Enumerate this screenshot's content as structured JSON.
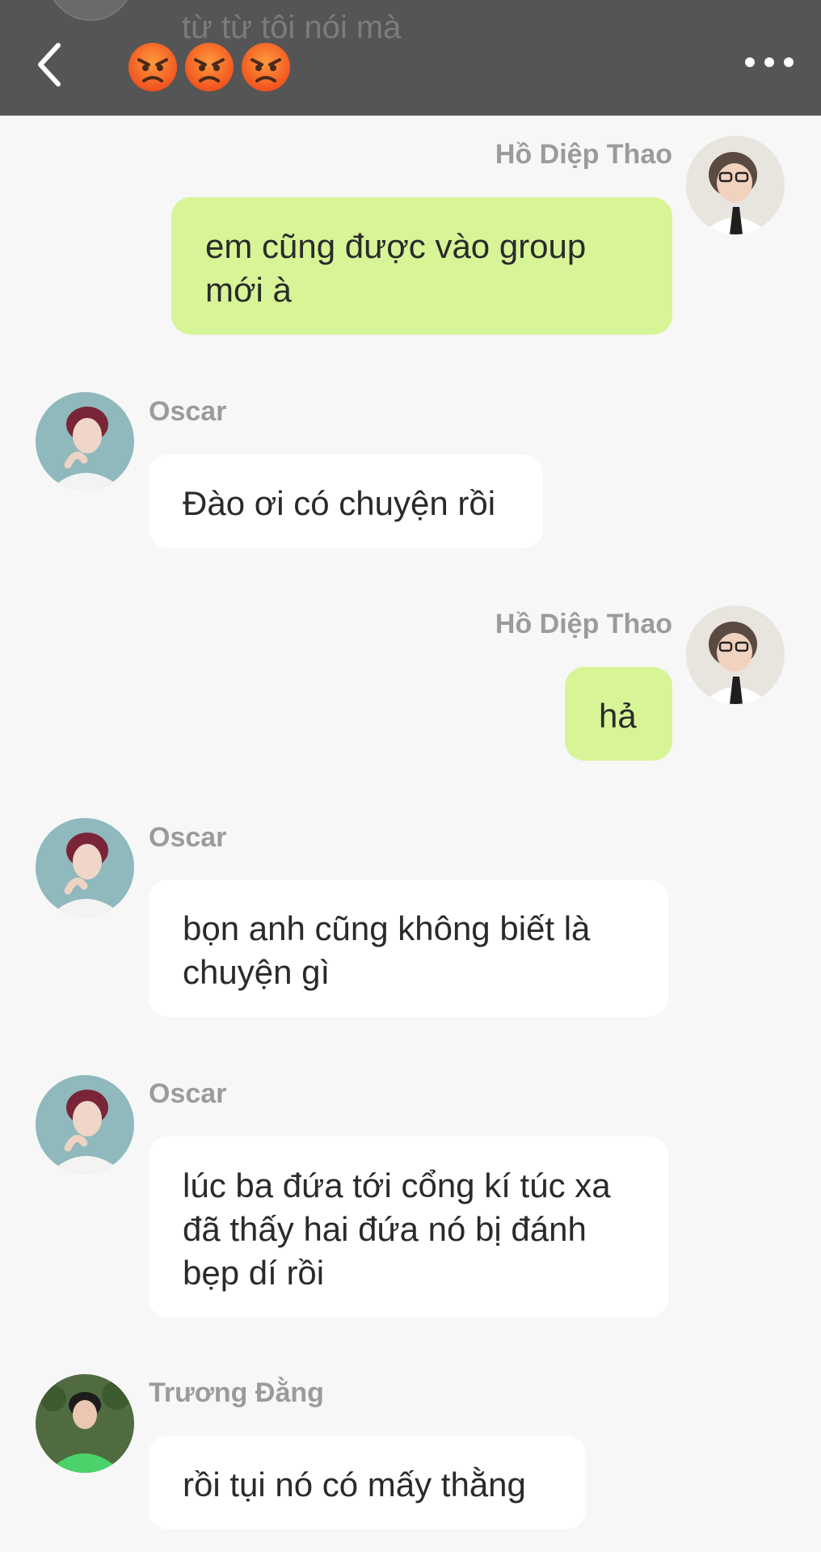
{
  "header": {
    "previous_message_preview": "từ từ tôi nói mà",
    "title_emojis": [
      "pouting-face-emoji",
      "pouting-face-emoji",
      "pouting-face-emoji"
    ],
    "back_icon": "chevron-left-icon",
    "more_icon": "more-horizontal-icon"
  },
  "colors": {
    "header_bg": "#555555",
    "chat_bg": "#f7f7f7",
    "my_bubble": "#d7f597",
    "other_bubble": "#ffffff",
    "sender_name": "#9b9b9b"
  },
  "messages": [
    {
      "sender": "Hồ Diệp Thao",
      "side": "right",
      "text": "em cũng được vào group mới à"
    },
    {
      "sender": "Oscar",
      "side": "left",
      "text": "Đào ơi có chuyện rồi"
    },
    {
      "sender": "Hồ Diệp Thao",
      "side": "right",
      "text": "hả"
    },
    {
      "sender": "Oscar",
      "side": "left",
      "text": "bọn anh cũng không biết là chuyện gì"
    },
    {
      "sender": "Oscar",
      "side": "left",
      "text": "lúc ba đứa tới cổng kí túc xa đã thấy hai đứa nó bị đánh bẹp dí rồi"
    },
    {
      "sender": "Trương Đằng",
      "side": "left",
      "text": "rồi tụi nó có mấy thằng"
    }
  ]
}
